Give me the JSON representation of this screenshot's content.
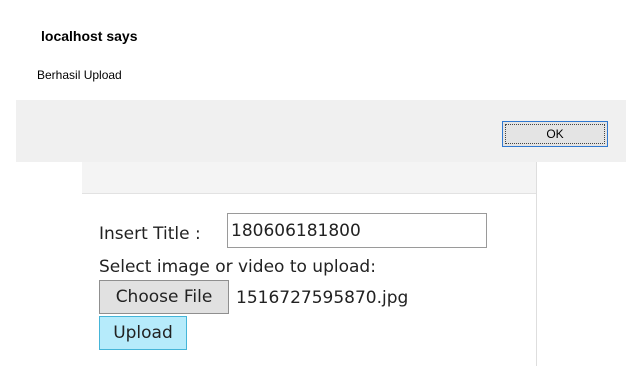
{
  "dialog": {
    "title": "localhost says",
    "message": "Berhasil Upload",
    "ok_label": "OK"
  },
  "form": {
    "title_label": "Insert Title :",
    "title_value": "180606181800",
    "select_label": "Select image or video to upload:",
    "choose_file_label": "Choose File",
    "file_name": "1516727595870.jpg",
    "upload_label": "Upload"
  },
  "colors": {
    "upload_button_bg": "#b6ebfb",
    "ok_button_border": "#2f78d0",
    "dialog_footer_bg": "#f0f0f0"
  }
}
